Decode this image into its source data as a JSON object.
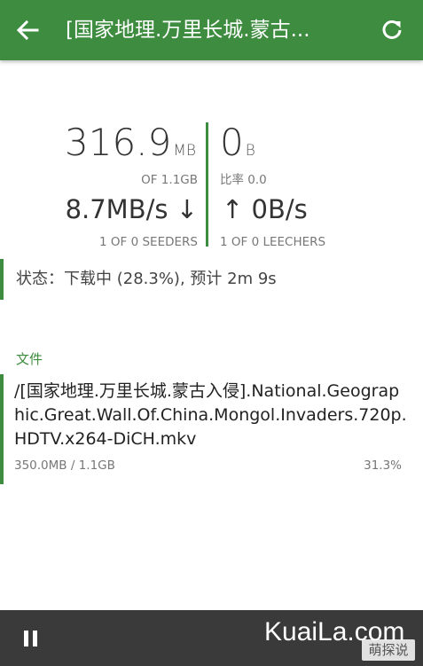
{
  "appbar": {
    "title": "[国家地理.万里长城.蒙古...",
    "back_icon": "arrow-left-icon",
    "refresh_icon": "refresh-icon"
  },
  "stats": {
    "downloaded_value": "316.9",
    "downloaded_unit": "MB",
    "downloaded_of": "OF 1.1GB",
    "uploaded_value": "0",
    "uploaded_unit": "B",
    "ratio": "比率 0.0",
    "download_speed": "8.7MB/s ↓",
    "upload_speed": "↑ 0B/s",
    "seeders": "1 OF 0 SEEDERS",
    "leechers": "1 OF 0 LEECHERS"
  },
  "status": {
    "text": "状态：下载中 (28.3%), 预计 2m 9s"
  },
  "files": {
    "label": "文件",
    "items": [
      {
        "name": "/[国家地理.万里长城.蒙古入侵].National.Geographic.Great.Wall.Of.China.Mongol.Invaders.720p.HDTV.x264-DiCH.mkv",
        "size": "350.0MB / 1.1GB",
        "percent": "31.3%"
      }
    ]
  },
  "bottombar": {
    "pause_icon": "pause-icon",
    "watermark": "KuaiLa.com",
    "watermark_badge": "萌探说"
  },
  "colors": {
    "accent": "#3d8c3f",
    "bottom_bar": "#3a3a3a"
  }
}
